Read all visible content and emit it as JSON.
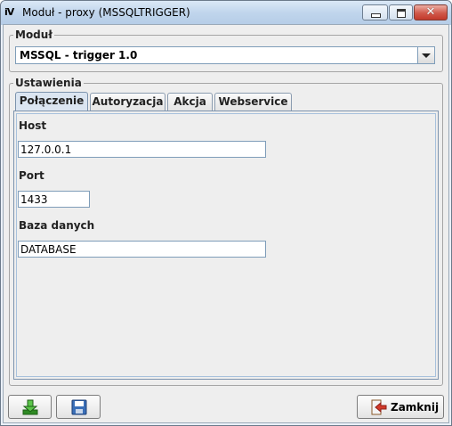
{
  "window": {
    "logo_text": "iV",
    "title": "Moduł - proxy (MSSQLTRIGGER)",
    "controls": [
      "minimize-icon",
      "maximize-icon",
      "close-icon"
    ],
    "close_glyph": "✕"
  },
  "module_group": {
    "legend": "Moduł",
    "selected": "MSSQL - trigger 1.0"
  },
  "settings_group": {
    "legend": "Ustawienia",
    "tabs": [
      {
        "label": "Połączenie",
        "active": true
      },
      {
        "label": "Autoryzacja",
        "active": false
      },
      {
        "label": "Akcja",
        "active": false
      },
      {
        "label": "Webservice",
        "active": false
      }
    ],
    "fields": {
      "host": {
        "label": "Host",
        "value": "127.0.0.1"
      },
      "port": {
        "label": "Port",
        "value": "1433"
      },
      "database": {
        "label": "Baza danych",
        "value": "DATABASE"
      }
    }
  },
  "footer": {
    "import_icon": "download-icon",
    "save_icon": "save-icon",
    "close_button": {
      "label": "Zamknij",
      "icon": "exit-icon"
    }
  },
  "colors": {
    "accent": "#7d93ad",
    "download_green": "#4caf3a",
    "save_blue": "#3a6fb8",
    "exit_red": "#d23a2a"
  }
}
